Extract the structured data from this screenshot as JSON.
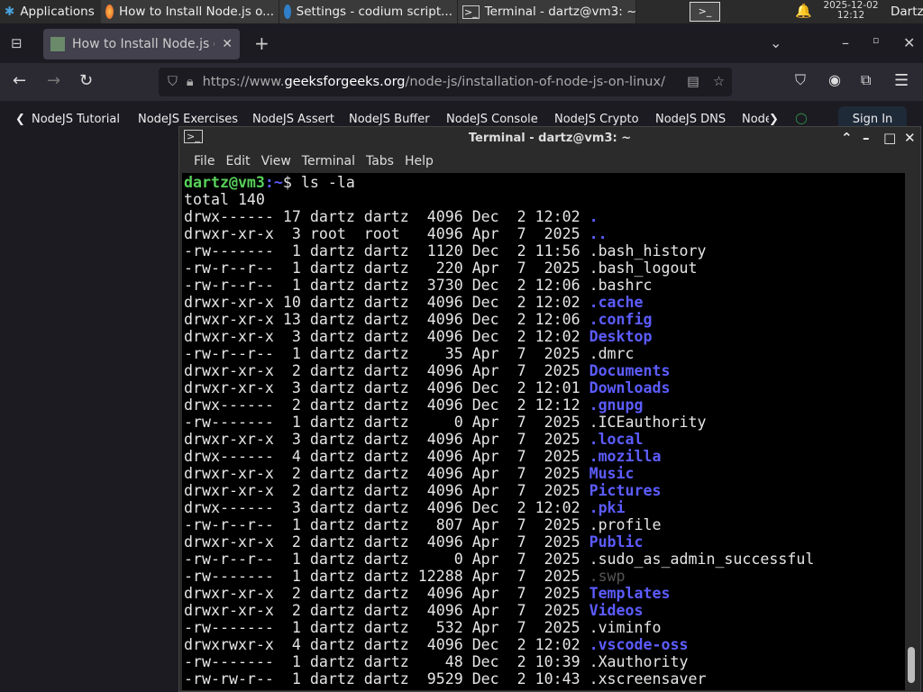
{
  "taskbar": {
    "applications": "Applications",
    "tasks": [
      "How to Install Node.js o...",
      "Settings - codium script...",
      "Terminal - dartz@vm3: ~"
    ],
    "date": "2025-12-02",
    "time": "12:12",
    "user": "Dartz"
  },
  "browser": {
    "tab_title": "How to Install Node.js or",
    "url_prefix": "https://www.",
    "url_domain": "geeksforgeeks.org",
    "url_path": "/node-js/installation-of-node-js-on-linux/",
    "bookmarks": [
      "NodeJS Tutorial",
      "NodeJS Exercises",
      "NodeJS Assert",
      "NodeJS Buffer",
      "NodeJS Console",
      "NodeJS Crypto",
      "NodeJS DNS",
      "Node"
    ],
    "sign_in": "Sign In"
  },
  "terminal": {
    "title": "Terminal - dartz@vm3: ~",
    "menu": [
      "File",
      "Edit",
      "View",
      "Terminal",
      "Tabs",
      "Help"
    ],
    "prompt_user": "dartz@vm3",
    "prompt_path": ":~",
    "prompt_sym": "$ ",
    "command": "ls -la",
    "total": "total 140",
    "entries": [
      {
        "meta": "drwx------ 17 dartz dartz  4096 Dec  2 12:02 ",
        "name": ".",
        "type": "dir"
      },
      {
        "meta": "drwxr-xr-x  3 root  root   4096 Apr  7  2025 ",
        "name": "..",
        "type": "dir"
      },
      {
        "meta": "-rw-------  1 dartz dartz  1120 Dec  2 11:56 ",
        "name": ".bash_history",
        "type": "file"
      },
      {
        "meta": "-rw-r--r--  1 dartz dartz   220 Apr  7  2025 ",
        "name": ".bash_logout",
        "type": "file"
      },
      {
        "meta": "-rw-r--r--  1 dartz dartz  3730 Dec  2 12:06 ",
        "name": ".bashrc",
        "type": "file"
      },
      {
        "meta": "drwxr-xr-x 10 dartz dartz  4096 Dec  2 12:02 ",
        "name": ".cache",
        "type": "dir"
      },
      {
        "meta": "drwxr-xr-x 13 dartz dartz  4096 Dec  2 12:06 ",
        "name": ".config",
        "type": "dir"
      },
      {
        "meta": "drwxr-xr-x  3 dartz dartz  4096 Dec  2 12:02 ",
        "name": "Desktop",
        "type": "dir"
      },
      {
        "meta": "-rw-r--r--  1 dartz dartz    35 Apr  7  2025 ",
        "name": ".dmrc",
        "type": "file"
      },
      {
        "meta": "drwxr-xr-x  2 dartz dartz  4096 Apr  7  2025 ",
        "name": "Documents",
        "type": "dir"
      },
      {
        "meta": "drwxr-xr-x  3 dartz dartz  4096 Dec  2 12:01 ",
        "name": "Downloads",
        "type": "dir"
      },
      {
        "meta": "drwx------  2 dartz dartz  4096 Dec  2 12:12 ",
        "name": ".gnupg",
        "type": "dir"
      },
      {
        "meta": "-rw-------  1 dartz dartz     0 Apr  7  2025 ",
        "name": ".ICEauthority",
        "type": "file"
      },
      {
        "meta": "drwxr-xr-x  3 dartz dartz  4096 Apr  7  2025 ",
        "name": ".local",
        "type": "dir"
      },
      {
        "meta": "drwx------  4 dartz dartz  4096 Apr  7  2025 ",
        "name": ".mozilla",
        "type": "dir"
      },
      {
        "meta": "drwxr-xr-x  2 dartz dartz  4096 Apr  7  2025 ",
        "name": "Music",
        "type": "dir"
      },
      {
        "meta": "drwxr-xr-x  2 dartz dartz  4096 Apr  7  2025 ",
        "name": "Pictures",
        "type": "dir"
      },
      {
        "meta": "drwx------  3 dartz dartz  4096 Dec  2 12:02 ",
        "name": ".pki",
        "type": "dir"
      },
      {
        "meta": "-rw-r--r--  1 dartz dartz   807 Apr  7  2025 ",
        "name": ".profile",
        "type": "file"
      },
      {
        "meta": "drwxr-xr-x  2 dartz dartz  4096 Apr  7  2025 ",
        "name": "Public",
        "type": "dir"
      },
      {
        "meta": "-rw-r--r--  1 dartz dartz     0 Apr  7  2025 ",
        "name": ".sudo_as_admin_successful",
        "type": "file"
      },
      {
        "meta": "-rw-------  1 dartz dartz 12288 Apr  7  2025 ",
        "name": ".swp",
        "type": "dim"
      },
      {
        "meta": "drwxr-xr-x  2 dartz dartz  4096 Apr  7  2025 ",
        "name": "Templates",
        "type": "dir"
      },
      {
        "meta": "drwxr-xr-x  2 dartz dartz  4096 Apr  7  2025 ",
        "name": "Videos",
        "type": "dir"
      },
      {
        "meta": "-rw-------  1 dartz dartz   532 Apr  7  2025 ",
        "name": ".viminfo",
        "type": "file"
      },
      {
        "meta": "drwxrwxr-x  4 dartz dartz  4096 Dec  2 12:02 ",
        "name": ".vscode-oss",
        "type": "dir"
      },
      {
        "meta": "-rw-------  1 dartz dartz    48 Dec  2 10:39 ",
        "name": ".Xauthority",
        "type": "file"
      },
      {
        "meta": "-rw-rw-r--  1 dartz dartz  9529 Dec  2 10:43 ",
        "name": ".xscreensaver",
        "type": "file"
      }
    ]
  }
}
